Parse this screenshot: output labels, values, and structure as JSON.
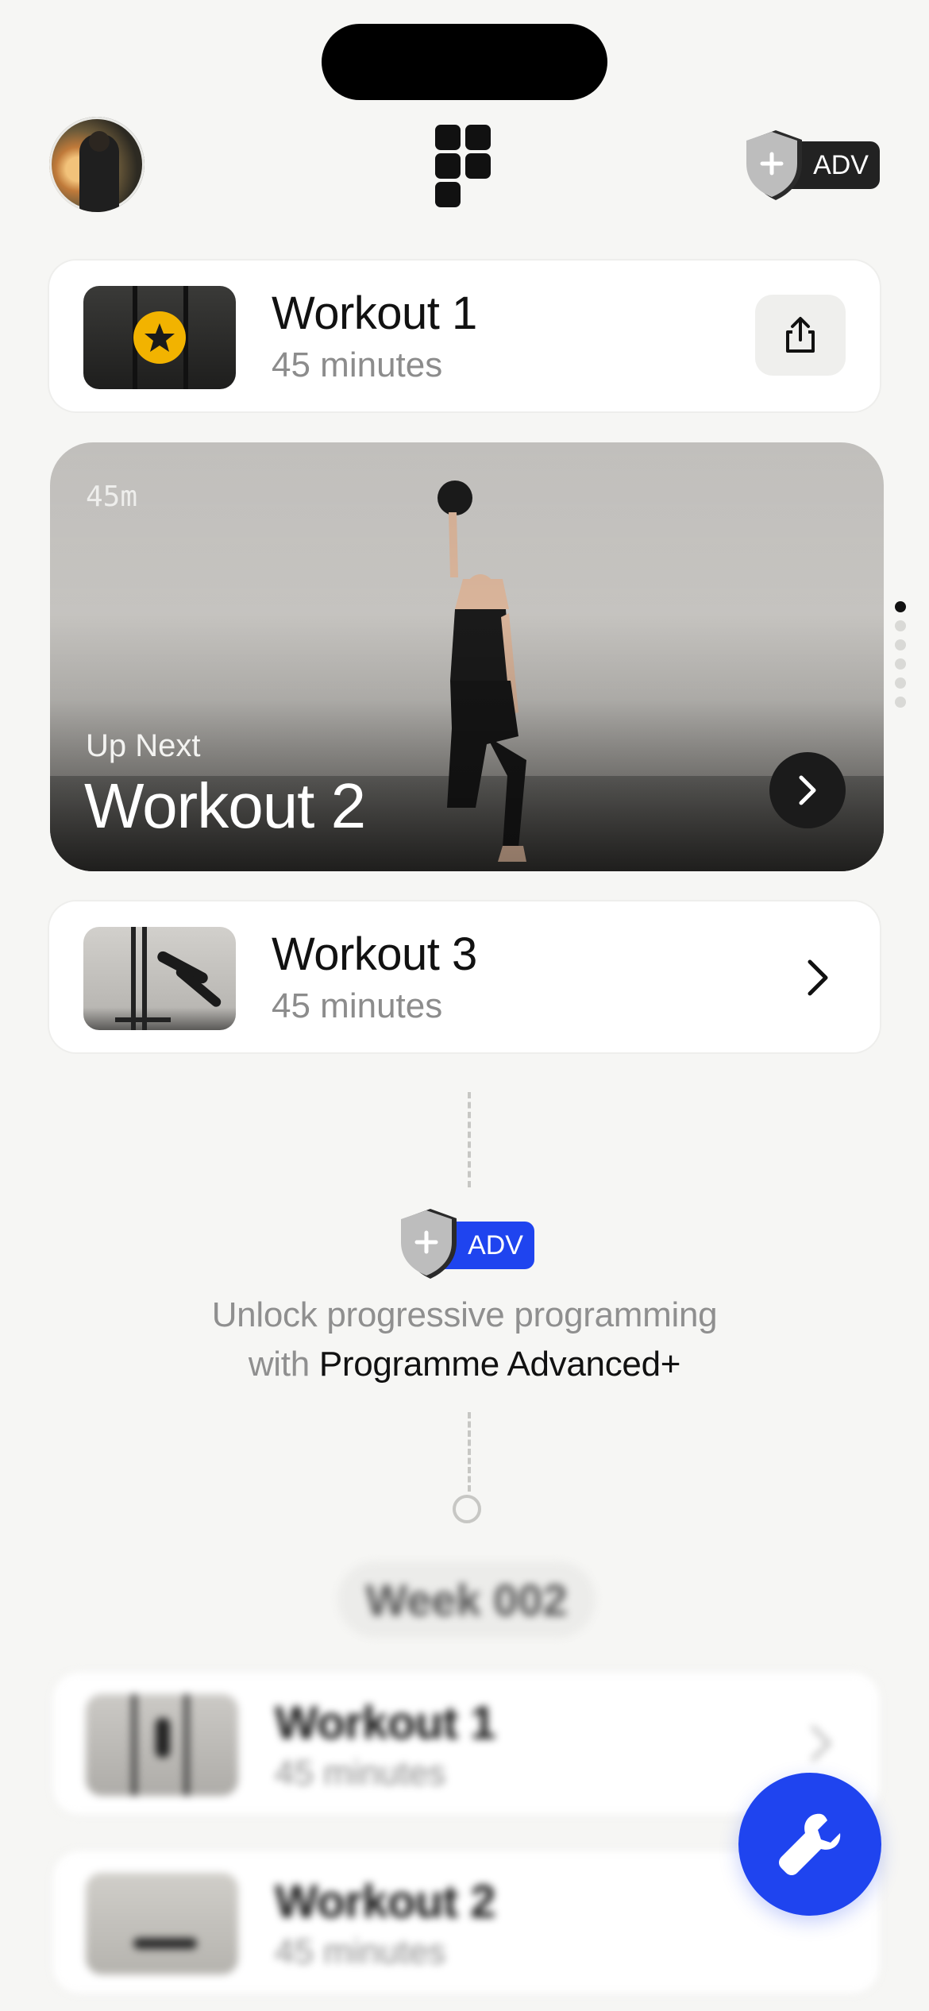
{
  "header": {
    "adv_badge": "ADV"
  },
  "current_workout": {
    "title": "Workout 1",
    "duration": "45 minutes"
  },
  "hero": {
    "duration_tag": "45m",
    "eyebrow": "Up Next",
    "title": "Workout 2"
  },
  "next_workout": {
    "title": "Workout 3",
    "duration": "45 minutes"
  },
  "upsell": {
    "badge": "ADV",
    "line1": "Unlock progressive programming",
    "line2_prefix": "with",
    "line2_strong": "Programme Advanced+"
  },
  "week": {
    "label": "Week 002",
    "items": [
      {
        "title": "Workout 1",
        "duration": "45 minutes"
      },
      {
        "title": "Workout 2",
        "duration": "45 minutes"
      }
    ]
  },
  "pagination": {
    "count": 6,
    "active_index": 0
  },
  "colors": {
    "accent_blue": "#1f44ef",
    "star_gold": "#f2b300",
    "badge_dark": "#222222"
  },
  "icons": [
    "avatar",
    "app-logo-icon",
    "shield-plus-icon",
    "star-icon",
    "share-icon",
    "chevron-right-icon",
    "wrench-icon"
  ]
}
